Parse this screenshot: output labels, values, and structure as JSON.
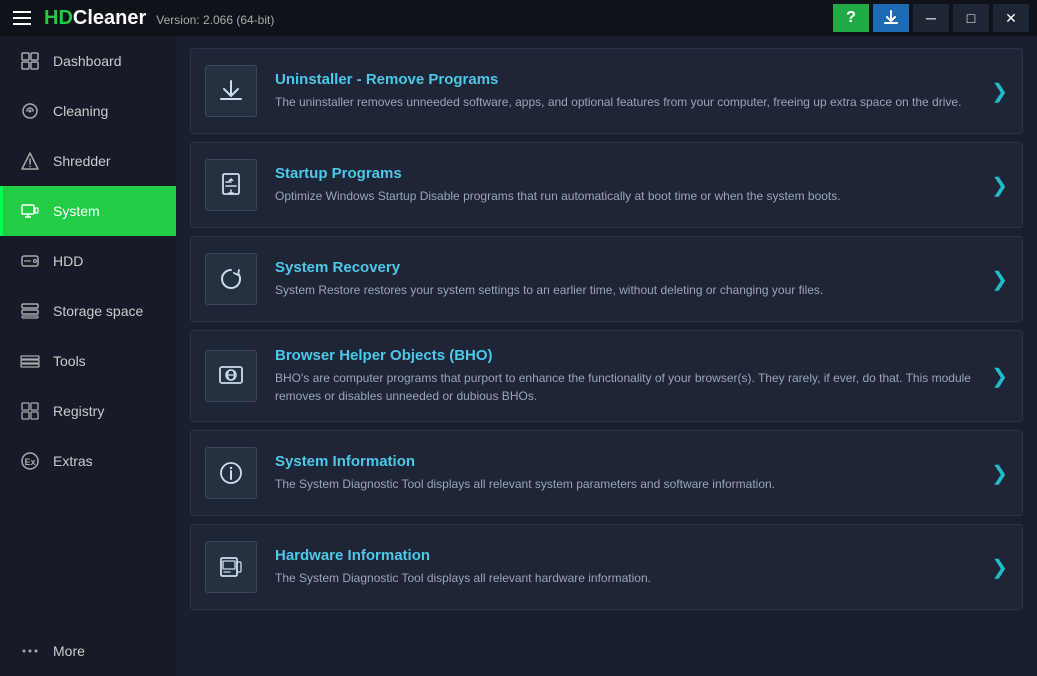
{
  "app": {
    "name_prefix": "HD",
    "name_suffix": "Cleaner",
    "version": "Version: 2.066 (64-bit)"
  },
  "titlebar": {
    "help_label": "?",
    "minimize_label": "─",
    "maximize_label": "□",
    "close_label": "✕"
  },
  "sidebar": {
    "items": [
      {
        "id": "dashboard",
        "label": "Dashboard",
        "active": false
      },
      {
        "id": "cleaning",
        "label": "Cleaning",
        "active": false
      },
      {
        "id": "shredder",
        "label": "Shredder",
        "active": false
      },
      {
        "id": "system",
        "label": "System",
        "active": true
      },
      {
        "id": "hdd",
        "label": "HDD",
        "active": false
      },
      {
        "id": "storage",
        "label": "Storage space",
        "active": false
      },
      {
        "id": "tools",
        "label": "Tools",
        "active": false
      },
      {
        "id": "registry",
        "label": "Registry",
        "active": false
      },
      {
        "id": "extras",
        "label": "Extras",
        "active": false
      },
      {
        "id": "more",
        "label": "More",
        "active": false
      }
    ]
  },
  "cards": [
    {
      "id": "uninstaller",
      "title": "Uninstaller - Remove Programs",
      "desc": "The uninstaller removes unneeded software, apps, and optional features from your computer, freeing up extra space on the drive."
    },
    {
      "id": "startup",
      "title": "Startup Programs",
      "desc": "Optimize Windows Startup Disable programs that run automatically at boot time or when the system boots."
    },
    {
      "id": "system-recovery",
      "title": "System Recovery",
      "desc": "System Restore restores your system settings to an earlier time, without deleting or changing your files."
    },
    {
      "id": "bho",
      "title": "Browser Helper Objects (BHO)",
      "desc": "BHO's are computer programs that purport to enhance the functionality of your browser(s). They rarely, if ever, do that. This module removes or disables unneeded or dubious BHOs."
    },
    {
      "id": "system-info",
      "title": "System Information",
      "desc": "The System Diagnostic Tool displays all relevant system parameters and software information."
    },
    {
      "id": "hardware-info",
      "title": "Hardware Information",
      "desc": "The System Diagnostic Tool displays all relevant hardware information."
    }
  ],
  "arrow": "❯"
}
